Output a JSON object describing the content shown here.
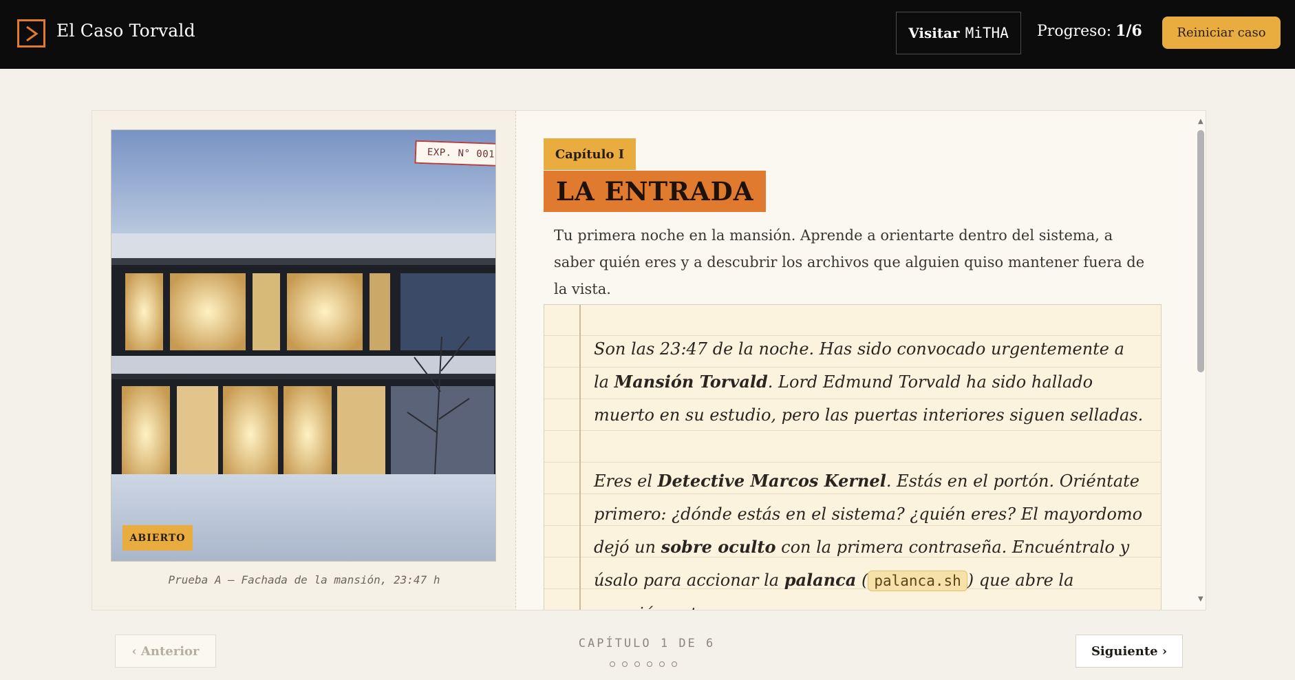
{
  "header": {
    "brand": "El Caso Torvald",
    "visit_label": "Visitar",
    "visit_brand": "MiTHA",
    "progress_label": "Progreso:",
    "progress_value": "1/6",
    "reset_label": "Reiniciar caso"
  },
  "evidence": {
    "exp_tag": "EXP. N° 001",
    "status_badge": "ABIERTO",
    "caption": "Prueba A — Fachada de la mansión, 23:47 h"
  },
  "chapter": {
    "tag": "Capítulo I",
    "title": "LA ENTRADA",
    "intro": "Tu primera noche en la mansión. Aprende a orientarte dentro del sistema, a saber quién eres y a descubrir los archivos que alguien quiso mantener fuera de la vista."
  },
  "notebook": {
    "p1": {
      "a": "Son las 23:47 de la noche. Has sido convocado urgentemente a la ",
      "b": "Mansión Torvald",
      "c": ". Lord Edmund Torvald ha sido hallado muerto en su estudio, pero las puertas interiores siguen selladas."
    },
    "p2": {
      "a": "Eres el ",
      "b": "Detective Marcos Kernel",
      "c": ". Estás en el portón. Oriéntate primero: ¿dónde estás en el sistema? ¿quién eres? El mayordomo dejó un ",
      "d": "sobre oculto",
      "e": " con la primera contraseña. Encuéntralo y úsalo para accionar la ",
      "f": "palanca",
      "g": " (",
      "code": "palanca.sh",
      "h": ") que abre la mansión entera."
    }
  },
  "footer": {
    "prev_label": "‹ Anterior",
    "next_label": "Siguiente ›",
    "chapter_counter": "CAPÍTULO 1 DE 6",
    "total_chapters": 6,
    "current_chapter": 1
  },
  "colors": {
    "topbar": "#0c0c0c",
    "accent_orange": "#e07a2e",
    "accent_gold": "#e9ad3f",
    "paper": "#fbf3dd"
  }
}
